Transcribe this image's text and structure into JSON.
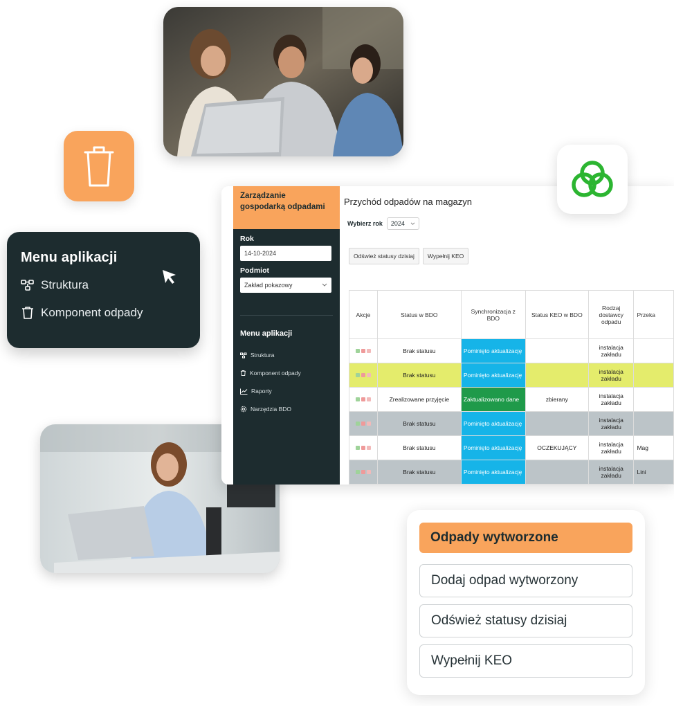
{
  "app": {
    "sidebar": {
      "title": "Zarządzanie gospodarką odpadami",
      "rok_label": "Rok",
      "rok_value": "14-10-2024",
      "podmiot_label": "Podmiot",
      "podmiot_value": "Zakład pokazowy",
      "menu_title": "Menu aplikacji",
      "items": [
        {
          "label": "Struktura",
          "icon": "structure-icon"
        },
        {
          "label": "Komponent odpady",
          "icon": "trash-icon"
        },
        {
          "label": "Raporty",
          "icon": "chart-icon"
        },
        {
          "label": "Narzędzia BDO",
          "icon": "gear-icon"
        }
      ]
    },
    "main": {
      "title": "Przychód odpadów na magazyn",
      "year_label": "Wybierz rok",
      "year_value": "2024",
      "buttons": [
        "Odśwież statusy dzisiaj",
        "Wypełnij KEO"
      ],
      "columns": [
        "Akcje",
        "Status w BDO",
        "Synchronizacja z BDO",
        "Status KEO w BDO",
        "Rodzaj dostawcy odpadu",
        "Przeka"
      ],
      "rows": [
        {
          "style": "white",
          "status": "Brak statusu",
          "sync": "Pominięto aktualizację",
          "sync_color": "#16b4e8",
          "keo": "",
          "rodzaj": "instalacja zakładu",
          "przek": ""
        },
        {
          "style": "yellow",
          "status": "Brak statusu",
          "sync": "Pominięto aktualizację",
          "sync_color": "#16b4e8",
          "keo": "",
          "rodzaj": "instalacja zakładu",
          "przek": ""
        },
        {
          "style": "white",
          "status": "Zrealizowane przyjęcie",
          "sync": "Zaktualizowano dane",
          "sync_color": "#1f9a4a",
          "keo": "zbierany",
          "rodzaj": "instalacja zakładu",
          "przek": ""
        },
        {
          "style": "grey",
          "status": "Brak statusu",
          "sync": "Pominięto aktualizację",
          "sync_color": "#16b4e8",
          "keo": "",
          "rodzaj": "instalacja zakładu",
          "przek": ""
        },
        {
          "style": "white",
          "status": "Brak statusu",
          "sync": "Pominięto aktualizację",
          "sync_color": "#16b4e8",
          "keo": "OCZEKUJĄCY",
          "rodzaj": "instalacja zakładu",
          "przek": "Mag"
        },
        {
          "style": "grey",
          "status": "Brak statusu",
          "sync": "Pominięto aktualizację",
          "sync_color": "#16b4e8",
          "keo": "",
          "rodzaj": "instalacja zakładu",
          "przek": "Lini"
        }
      ]
    }
  },
  "menu_card": {
    "title": "Menu aplikacji",
    "items": [
      {
        "label": "Struktura",
        "icon": "structure-icon"
      },
      {
        "label": "Komponent odpady",
        "icon": "trash-icon"
      }
    ]
  },
  "waste_card": {
    "title": "Odpady wytworzone",
    "buttons": [
      "Dodaj odpad wytworzony",
      "Odśwież statusy dzisiaj",
      "Wypełnij KEO"
    ]
  },
  "colors": {
    "accent_orange": "#f9a45c",
    "dark_teal": "#1d2c2f",
    "logo_green": "#2cb531",
    "sync_blue": "#16b4e8",
    "sync_green": "#1f9a4a",
    "row_yellow": "#e4ec6c",
    "row_grey": "#bcc4c8"
  }
}
